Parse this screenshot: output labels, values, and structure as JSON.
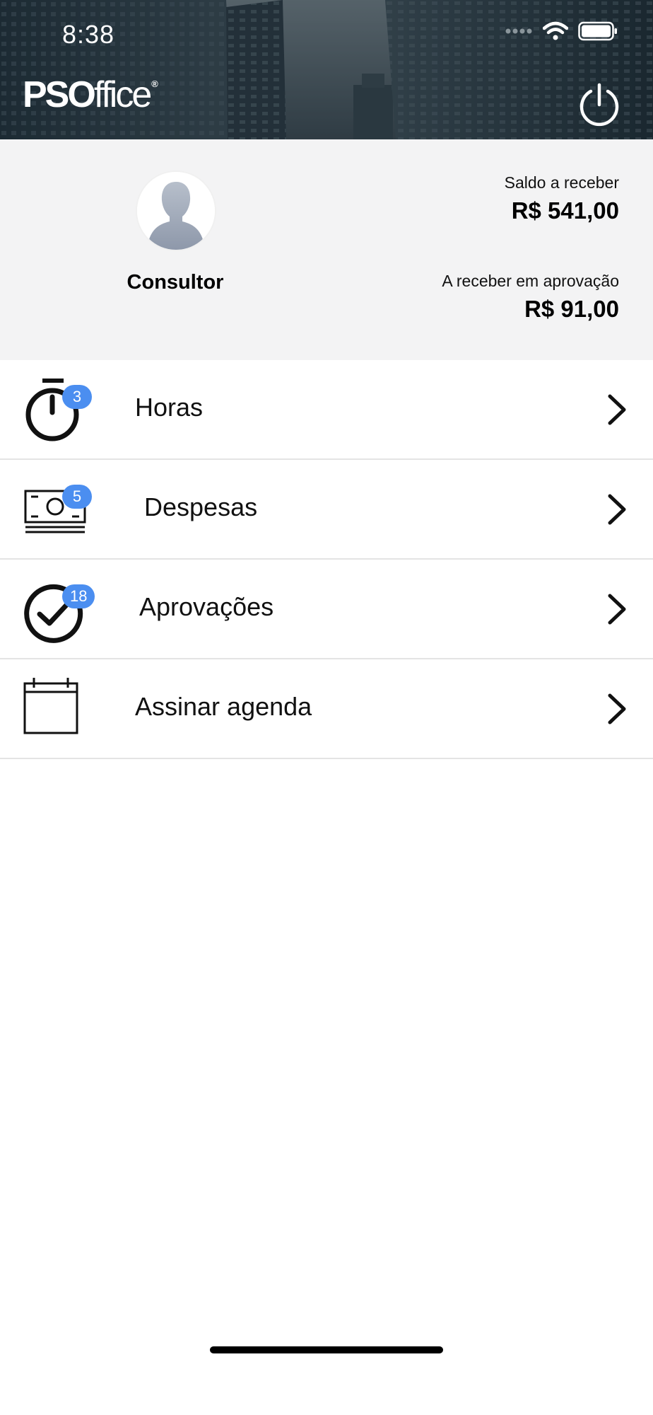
{
  "status_bar": {
    "time": "8:38",
    "icons": [
      "signal-icon",
      "wifi-icon",
      "battery-icon"
    ]
  },
  "header": {
    "logo_bold": "PSO",
    "logo_light": "ffice",
    "logo_mark": "®",
    "power_icon": "power-icon"
  },
  "profile": {
    "name": "Consultor",
    "avatar_icon": "user-silhouette-icon",
    "balance_label": "Saldo a receber",
    "balance_value": "R$ 541,00",
    "pending_label": "A receber em aprovação",
    "pending_value": "R$ 91,00"
  },
  "menu": {
    "items": [
      {
        "label": "Horas",
        "icon": "stopwatch-icon",
        "badge": "3"
      },
      {
        "label": "Despesas",
        "icon": "money-icon",
        "badge": "5"
      },
      {
        "label": "Aprovações",
        "icon": "check-circle-icon",
        "badge": "18"
      },
      {
        "label": "Assinar agenda",
        "icon": "calendar-icon",
        "badge": ""
      }
    ]
  },
  "colors": {
    "badge": "#4b8ef0",
    "profile_bg": "#f3f3f4",
    "header_bg": "#2f3d47"
  }
}
